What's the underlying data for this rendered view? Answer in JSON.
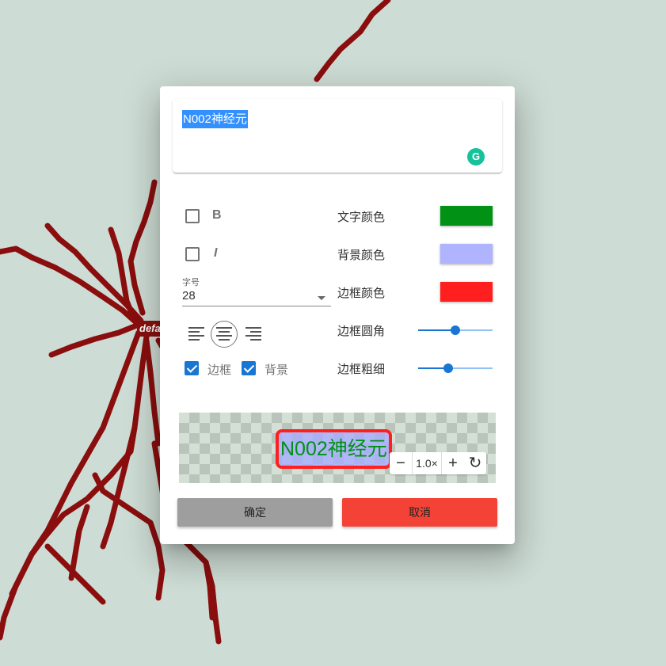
{
  "label_text": "N002神经元",
  "background_tag": "defa",
  "format": {
    "bold_label": "B",
    "italic_label": "I",
    "bold_checked": false,
    "italic_checked": false
  },
  "font_size": {
    "caption": "字号",
    "value": "28"
  },
  "alignment": {
    "options": [
      "left",
      "center",
      "right"
    ],
    "selected": "center"
  },
  "border_toggle": {
    "label": "边框",
    "checked": true
  },
  "background_toggle": {
    "label": "背景",
    "checked": true
  },
  "colors": {
    "text_color_label": "文字颜色",
    "text_color": "#009115",
    "background_color_label": "背景颜色",
    "background_color": "#b0b4ff",
    "border_color_label": "边框颜色",
    "border_color": "#ff1f1f",
    "neuron_color": "#8a0e0e",
    "accent": "#1976d2"
  },
  "sliders": {
    "border_radius_label": "边框圆角",
    "border_radius_fraction": 0.5,
    "border_width_label": "边框粗细",
    "border_width_fraction": 0.4
  },
  "preview": {
    "text": "N002神经元",
    "zoom_minus": "−",
    "zoom_value": "1.0×",
    "zoom_plus": "+",
    "reset_icon": "↻"
  },
  "buttons": {
    "confirm": "确定",
    "cancel": "取消",
    "confirm_color": "#9e9e9e",
    "cancel_color": "#f44336"
  }
}
